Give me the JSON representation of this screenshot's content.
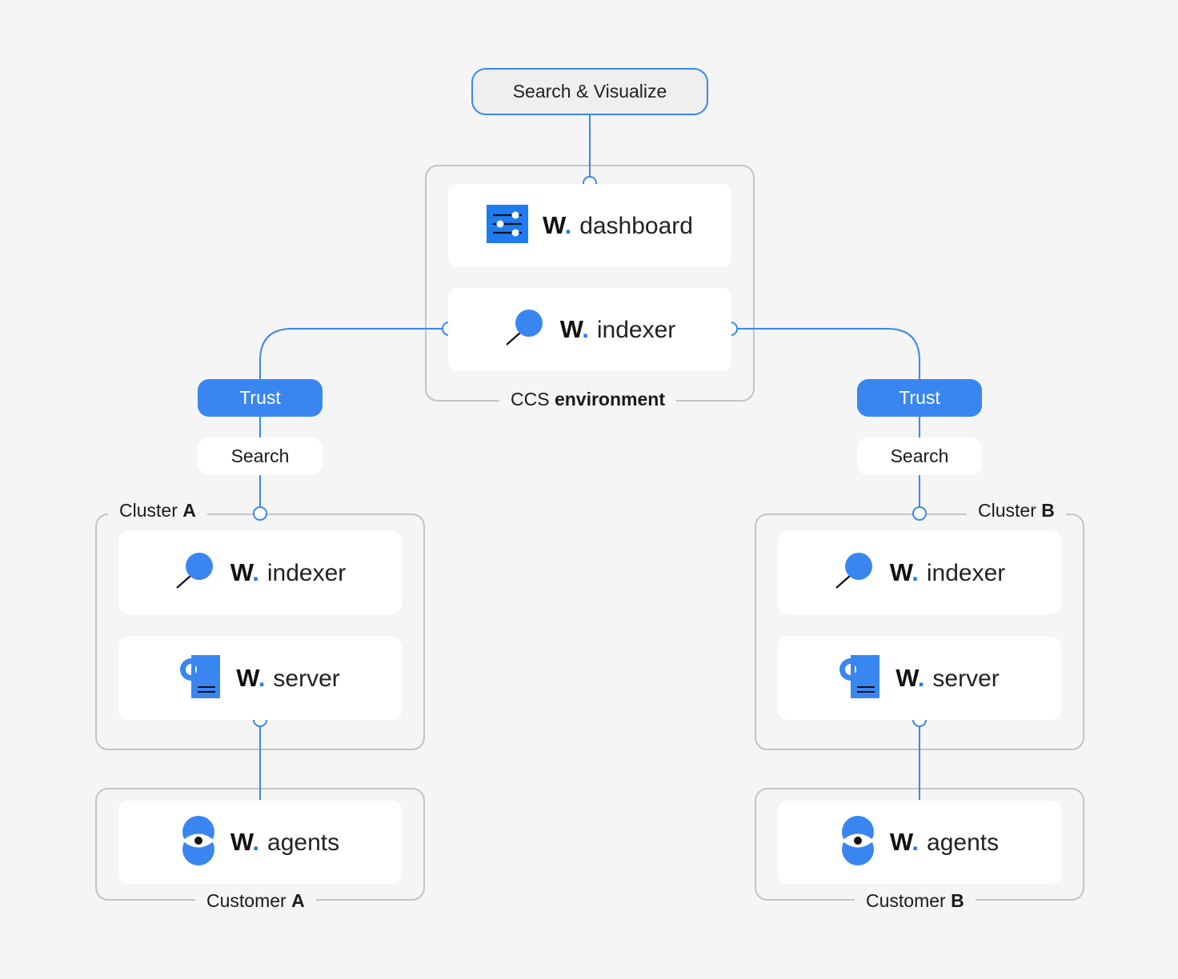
{
  "colors": {
    "accent": "#3a86f0",
    "background": "#f5f5f5",
    "border": "#c4c4c4",
    "card": "#ffffff"
  },
  "top_node": {
    "label": "Search & Visualize"
  },
  "ccs": {
    "label_prefix": "CCS",
    "label_bold": "environment",
    "dashboard": {
      "brand": "W",
      "dot": ".",
      "name": "dashboard",
      "icon": "sliders-icon"
    },
    "indexer": {
      "brand": "W",
      "dot": ".",
      "name": "indexer",
      "icon": "magnifier-icon"
    }
  },
  "connectors": {
    "left": {
      "trust": "Trust",
      "search": "Search"
    },
    "right": {
      "trust": "Trust",
      "search": "Search"
    }
  },
  "cluster_a": {
    "label_prefix": "Cluster",
    "label_bold": "A",
    "indexer": {
      "brand": "W",
      "dot": ".",
      "name": "indexer",
      "icon": "magnifier-icon"
    },
    "server": {
      "brand": "W",
      "dot": ".",
      "name": "server",
      "icon": "server-icon"
    }
  },
  "cluster_b": {
    "label_prefix": "Cluster",
    "label_bold": "B",
    "indexer": {
      "brand": "W",
      "dot": ".",
      "name": "indexer",
      "icon": "magnifier-icon"
    },
    "server": {
      "brand": "W",
      "dot": ".",
      "name": "server",
      "icon": "server-icon"
    }
  },
  "customer_a": {
    "label_prefix": "Customer",
    "label_bold": "A",
    "agents": {
      "brand": "W",
      "dot": ".",
      "name": "agents",
      "icon": "eye-icon"
    }
  },
  "customer_b": {
    "label_prefix": "Customer",
    "label_bold": "B",
    "agents": {
      "brand": "W",
      "dot": ".",
      "name": "agents",
      "icon": "eye-icon"
    }
  }
}
